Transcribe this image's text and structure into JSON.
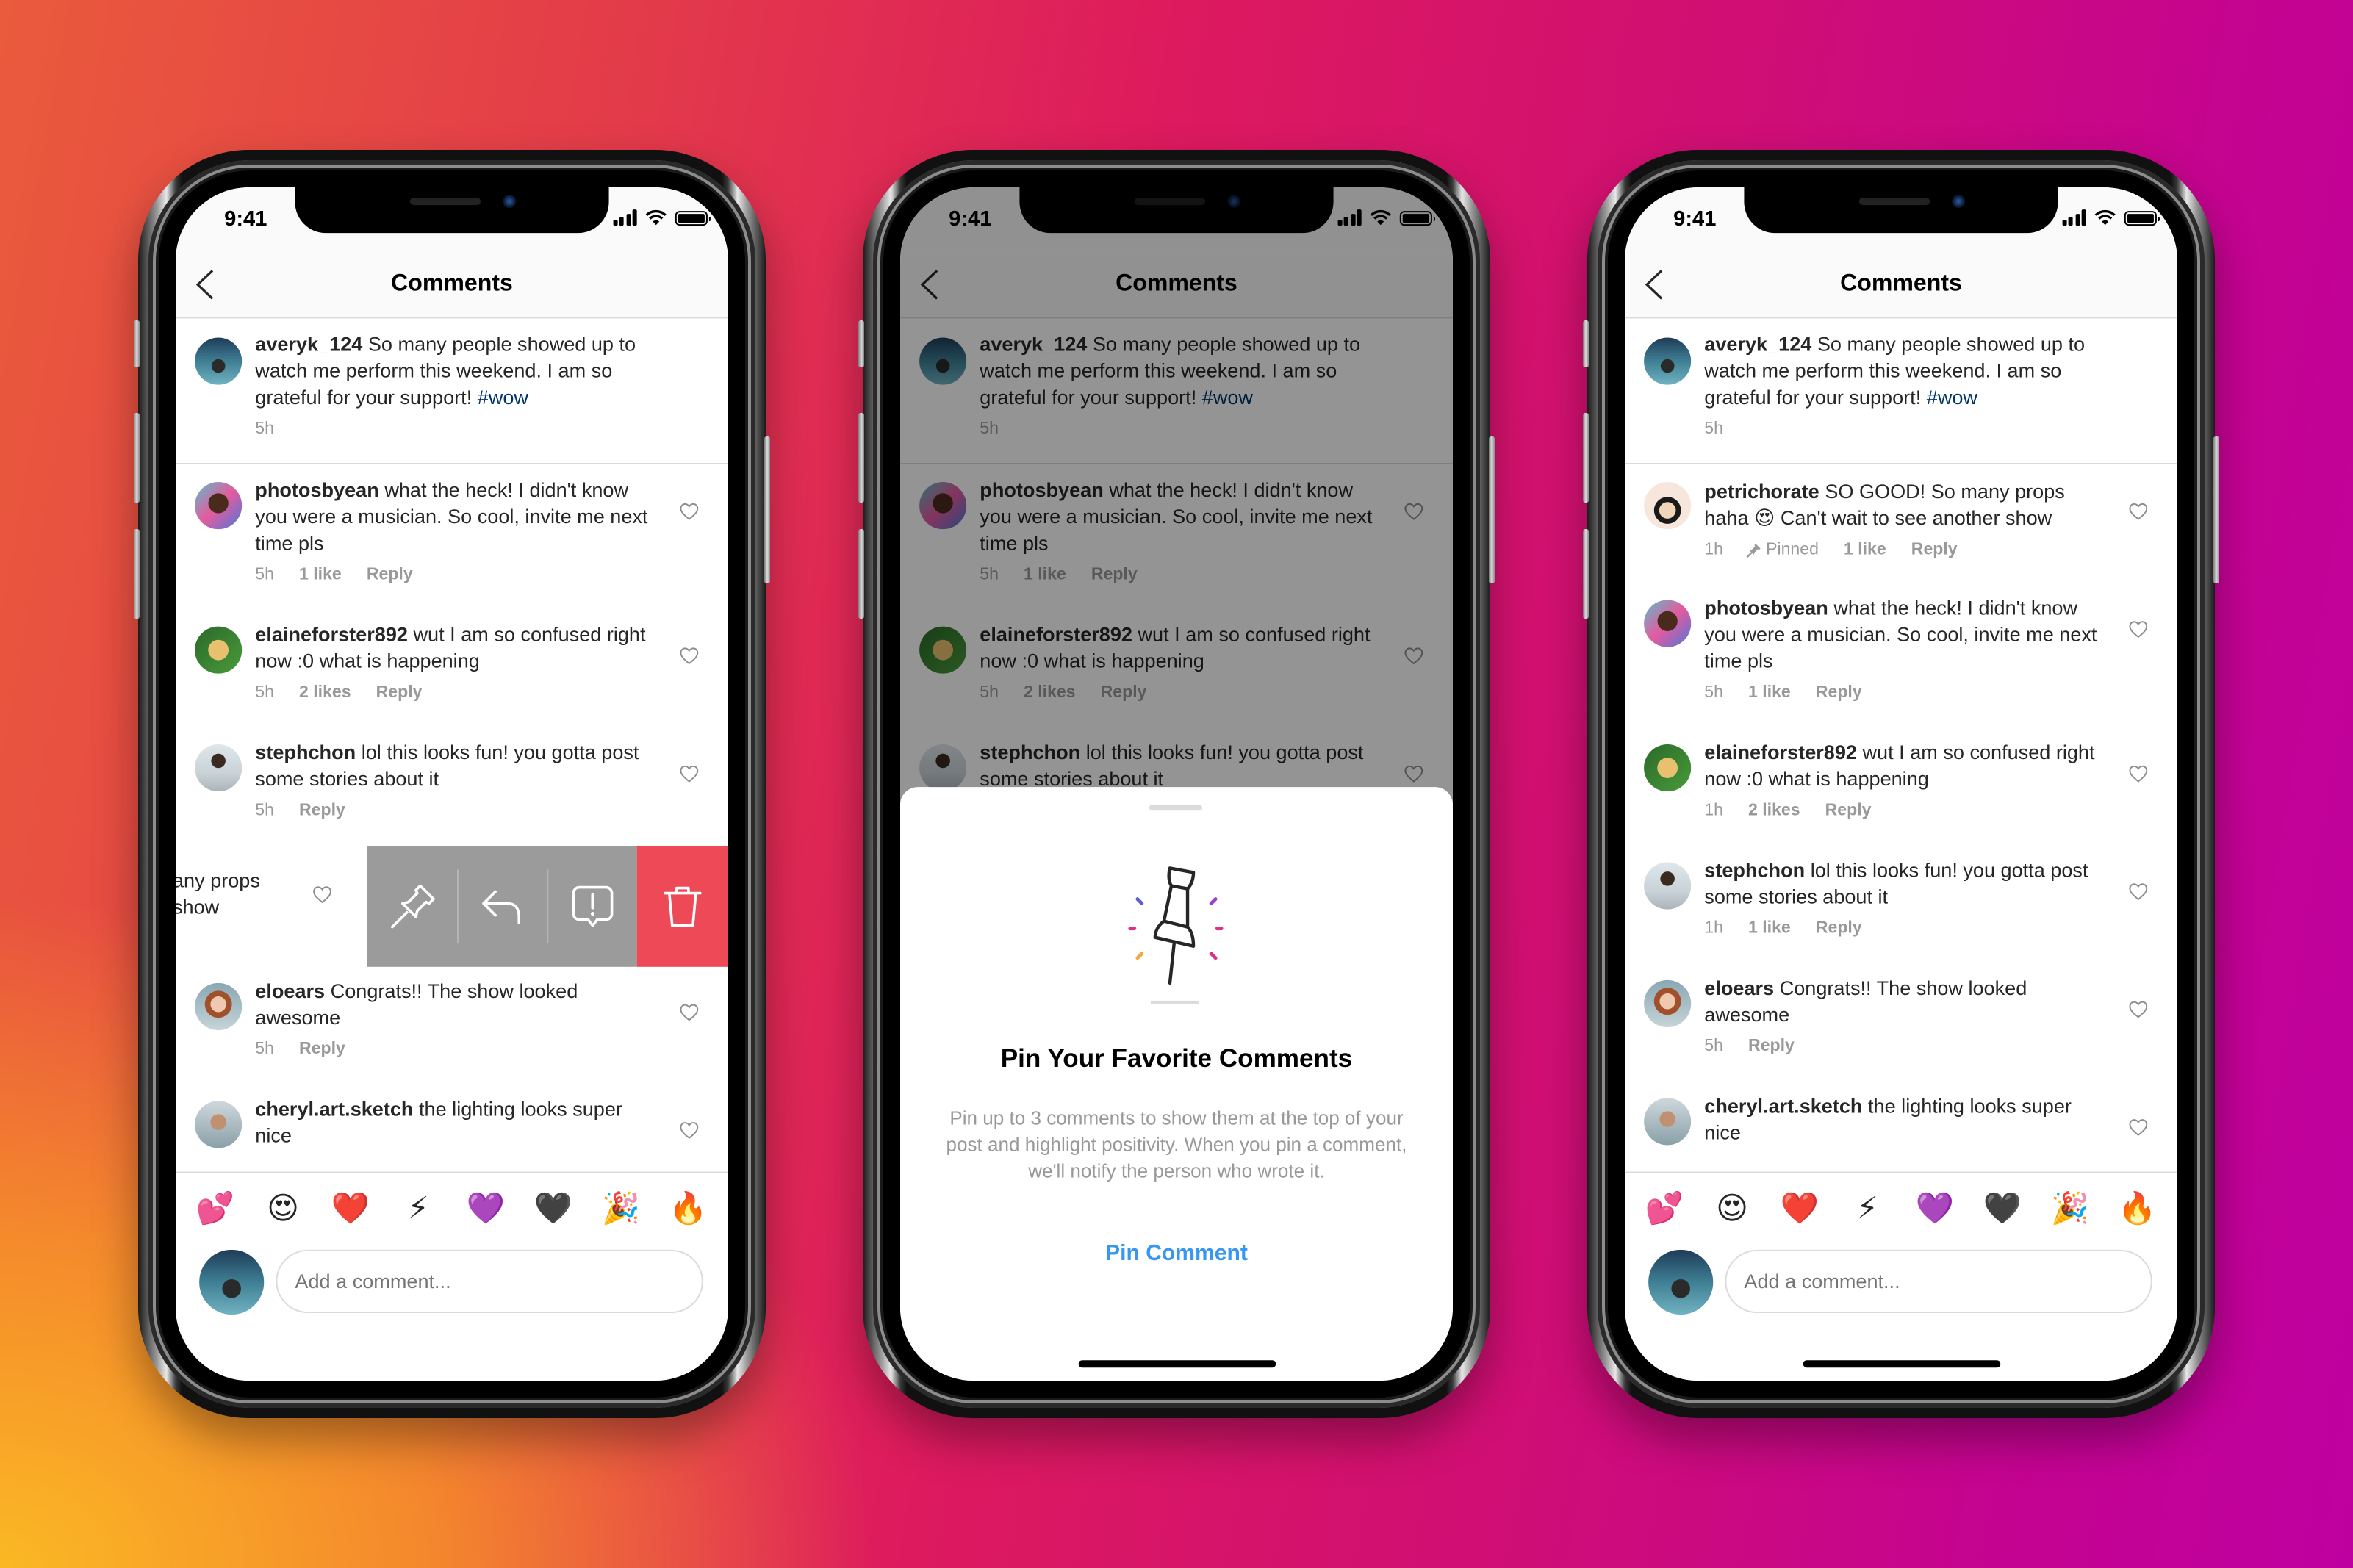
{
  "colors": {
    "link": "#003569",
    "action_blue": "#3897f0",
    "delete_red": "#ed4956",
    "swipe_gray": "#9b9b9b",
    "meta_gray": "#999999",
    "divider": "#dbdbdb"
  },
  "phones": [
    {
      "id": "phone-swipe-actions",
      "status": {
        "time": "9:41"
      },
      "header": {
        "title": "Comments",
        "back_icon": "chevron-left-icon"
      },
      "caption": {
        "username": "averyk_124",
        "text": "So many people showed up to watch me perform this weekend. I am so grateful for your support!",
        "hashtag": "#wow",
        "time": "5h"
      },
      "comments": [
        {
          "username": "photosbyean",
          "text": "what the heck! I didn't know you were a musician. So cool, invite me next time pls",
          "time": "5h",
          "likes": "1 like",
          "reply": "Reply"
        },
        {
          "username": "elaineforster892",
          "text": "wut I am so confused right now :0 what is happening",
          "time": "5h",
          "likes": "2 likes",
          "reply": "Reply"
        },
        {
          "username": "stephchon",
          "text": "lol this looks fun! you gotta post some stories about it",
          "time": "5h",
          "likes": "",
          "reply": "Reply"
        }
      ],
      "swiped_comment": {
        "visible_text_line1": "any props",
        "visible_text_line2": "show",
        "actions": [
          {
            "name": "pin",
            "icon": "pin-icon"
          },
          {
            "name": "reply",
            "icon": "reply-arrow-icon"
          },
          {
            "name": "report",
            "icon": "report-bubble-icon"
          },
          {
            "name": "delete",
            "icon": "trash-icon"
          }
        ]
      },
      "comments_after": [
        {
          "username": "eloears",
          "text": "Congrats!! The show looked awesome",
          "time": "5h",
          "likes": "",
          "reply": "Reply"
        },
        {
          "username": "cheryl.art.sketch",
          "text": "the lighting looks super nice",
          "time": "",
          "likes": "",
          "reply": ""
        }
      ],
      "emoji_bar": [
        "💕",
        "😍",
        "❤️",
        "⚡",
        "💜",
        "🖤",
        "🎉",
        "🔥"
      ],
      "composer": {
        "placeholder": "Add a comment..."
      }
    },
    {
      "id": "phone-pin-sheet",
      "status": {
        "time": "9:41"
      },
      "header": {
        "title": "Comments",
        "back_icon": "chevron-left-icon"
      },
      "caption": {
        "username": "averyk_124",
        "text": "So many people showed up to watch me perform this weekend. I am so grateful for your support!",
        "hashtag": "#wow",
        "time": "5h"
      },
      "comments": [
        {
          "username": "photosbyean",
          "text": "what the heck! I didn't know you were a musician. So cool, invite me next time pls",
          "time": "5h",
          "likes": "1 like",
          "reply": "Reply"
        },
        {
          "username": "elaineforster892",
          "text": "wut I am so confused right now :0 what is happening",
          "time": "5h",
          "likes": "2 likes",
          "reply": "Reply"
        },
        {
          "username": "stephchon",
          "text": "lol this looks fun! you gotta post some stories about it",
          "time": "",
          "likes": "",
          "reply": ""
        }
      ],
      "sheet": {
        "title": "Pin Your Favorite Comments",
        "body": "Pin up to 3 comments to show them at the top of your post and highlight positivity. When you pin a comment, we'll notify the person who wrote it.",
        "button": "Pin Comment",
        "illustration": "pushpin-icon",
        "sparkle_colors": [
          "#5b5fd6",
          "#9b3fd0",
          "#d8328a",
          "#d8328a",
          "#f5a93a",
          "#d8328a"
        ]
      }
    },
    {
      "id": "phone-pinned",
      "status": {
        "time": "9:41"
      },
      "header": {
        "title": "Comments",
        "back_icon": "chevron-left-icon"
      },
      "caption": {
        "username": "averyk_124",
        "text": "So many people showed up to watch me perform this weekend. I am so grateful for your support!",
        "hashtag": "#wow",
        "time": "5h"
      },
      "pinned_comment": {
        "username": "petrichorate",
        "text_before_emoji": "SO GOOD! So many props haha",
        "emoji": "😍",
        "text_after_emoji": "Can't wait to see another show",
        "time": "1h",
        "pinned_label": "Pinned",
        "likes": "1 like",
        "reply": "Reply"
      },
      "comments": [
        {
          "username": "photosbyean",
          "text": "what the heck! I didn't know you were a musician. So cool, invite me next time pls",
          "time": "5h",
          "likes": "1 like",
          "reply": "Reply"
        },
        {
          "username": "elaineforster892",
          "text": "wut I am so confused right now :0 what is happening",
          "time": "1h",
          "likes": "2 likes",
          "reply": "Reply"
        },
        {
          "username": "stephchon",
          "text": "lol this looks fun! you gotta post some stories about it",
          "time": "1h",
          "likes": "1 like",
          "reply": "Reply"
        },
        {
          "username": "eloears",
          "text": "Congrats!! The show looked awesome",
          "time": "5h",
          "likes": "",
          "reply": "Reply"
        },
        {
          "username": "cheryl.art.sketch",
          "text": "the lighting looks super nice",
          "time": "",
          "likes": "",
          "reply": ""
        }
      ],
      "emoji_bar": [
        "💕",
        "😍",
        "❤️",
        "⚡",
        "💜",
        "🖤",
        "🎉",
        "🔥"
      ],
      "composer": {
        "placeholder": "Add a comment..."
      }
    }
  ]
}
